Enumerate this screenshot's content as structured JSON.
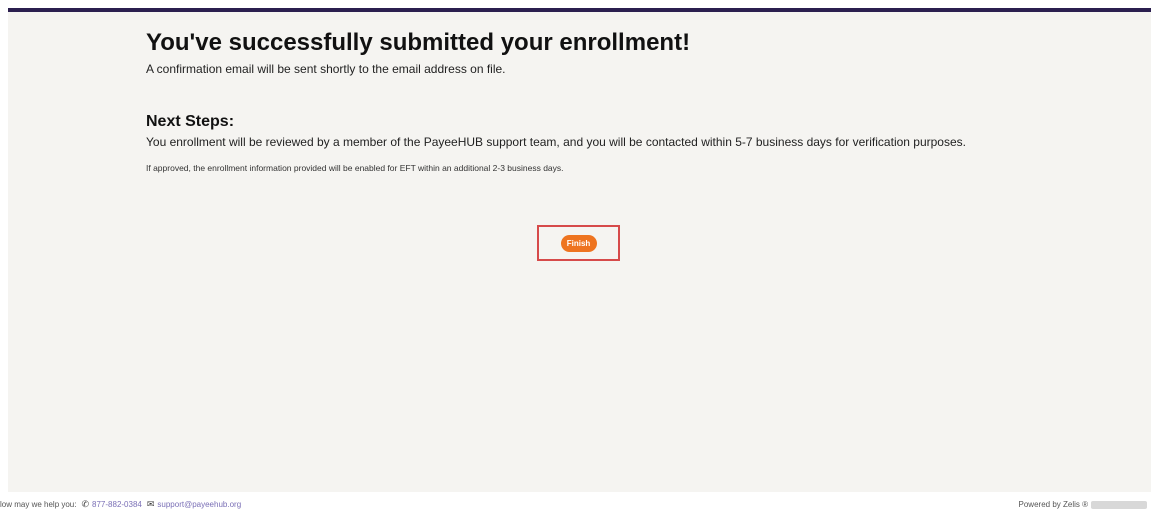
{
  "confirmation": {
    "title": "You've successfully submitted your enrollment!",
    "subtitle": "A confirmation email will be sent shortly to the email address on file."
  },
  "next_steps": {
    "heading": "Next Steps:",
    "body": "You enrollment will be reviewed by a member of the PayeeHUB support team, and you will be contacted within 5-7 business days for verification purposes.",
    "note": "If approved, the enrollment information provided will be enabled for EFT within an additional 2-3 business days."
  },
  "actions": {
    "finish_label": "Finish"
  },
  "footer": {
    "help_label": "low may we help you:",
    "phone_icon": "phone-icon",
    "phone": "877-882-0384",
    "email_icon": "envelope-icon",
    "email": "support@payeehub.org",
    "powered_by": "Powered by Zelis ®"
  },
  "colors": {
    "top_bar": "#2b1f4f",
    "panel_bg": "#f5f4f1",
    "finish_button": "#ee7420",
    "highlight_box": "#d64a4a",
    "link": "#7a6fb6"
  }
}
